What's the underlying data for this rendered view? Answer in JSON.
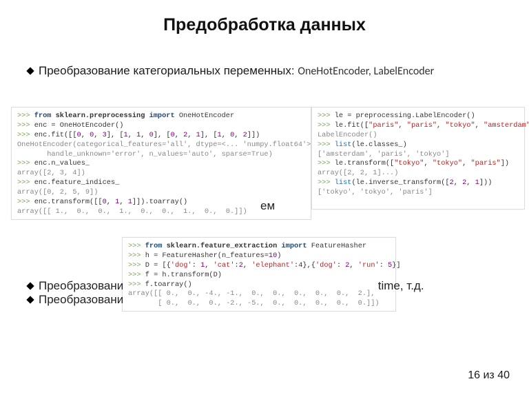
{
  "title": "Предобработка данных",
  "bullet1_text": "Преобразование категориальных переменных: ",
  "bullet1_enc": "OneHotEncoder, LabelEncoder",
  "code_left": {
    "l1a": ">>> ",
    "l1b": "from",
    "l1c": " sklearn.preprocessing ",
    "l1d": "import",
    "l1e": " OneHotEncoder",
    "l2a": ">>> ",
    "l2b": "enc = OneHotEncoder()",
    "l3a": ">>> ",
    "l3b": "enc.fit([[",
    "l3c": "0",
    "l3d": ", ",
    "l3e": "0",
    "l3f": ", ",
    "l3g": "3",
    "l3h": "], [",
    "l3i": "1",
    "l3j": ", ",
    "l3k": "1",
    "l3l": ", ",
    "l3m": "0",
    "l3n": "], [",
    "l3o": "0",
    "l3p": ", ",
    "l3q": "2",
    "l3r": ", ",
    "l3s": "1",
    "l3t": "], [",
    "l3u": "1",
    "l3v": ", ",
    "l3w": "0",
    "l3x": ", ",
    "l3y": "2",
    "l3z": "]])",
    "l4": "OneHotEncoder(categorical_features='all', dtype=<... 'numpy.float64'>,",
    "l5": "       handle_unknown='error', n_values='auto', sparse=True)",
    "l6a": ">>> ",
    "l6b": "enc.n_values_",
    "l7": "array([2, 3, 4])",
    "l8a": ">>> ",
    "l8b": "enc.feature_indices_",
    "l9": "array([0, 2, 5, 9])",
    "l10a": ">>> ",
    "l10b": "enc.transform([[",
    "l10c": "0",
    "l10d": ", ",
    "l10e": "1",
    "l10f": ", ",
    "l10g": "1",
    "l10h": "]]).toarray()",
    "l11": "array([[ 1.,  0.,  0.,  1.,  0.,  0.,  1.,  0.,  0.]])"
  },
  "code_right": {
    "l1a": ">>> ",
    "l1b": "le = preprocessing.LabelEncoder()",
    "l2a": ">>> ",
    "l2b": "le.fit([",
    "l2c": "\"paris\"",
    "l2d": ", ",
    "l2e": "\"paris\"",
    "l2f": ", ",
    "l2g": "\"tokyo\"",
    "l2h": ", ",
    "l2i": "\"amsterdam\"",
    "l2j": "])",
    "l3": "LabelEncoder()",
    "l4a": ">>> ",
    "l4b": "list",
    "l4c": "(le.classes_)",
    "l5": "['amsterdam', 'paris', 'tokyo']",
    "l6a": ">>> ",
    "l6b": "le.transform([",
    "l6c": "\"tokyo\"",
    "l6d": ", ",
    "l6e": "\"tokyo\"",
    "l6f": ", ",
    "l6g": "\"paris\"",
    "l6h": "])",
    "l7": "array([2, 2, 1]...)",
    "l8a": ">>> ",
    "l8b": "list",
    "l8c": "(le.inverse_transform([",
    "l8d": "2",
    "l8e": ", ",
    "l8f": "2",
    "l8g": ", ",
    "l8h": "1",
    "l8i": "]))",
    "l9": "['tokyo', 'tokyo', 'paris']"
  },
  "code_bottom": {
    "l1a": ">>> ",
    "l1b": "from",
    "l1c": " sklearn.feature_extraction ",
    "l1d": "import",
    "l1e": " FeatureHasher",
    "l2a": ">>> ",
    "l2b": "h = FeatureHasher(n_features=",
    "l2c": "10",
    "l2d": ")",
    "l3a": ">>> ",
    "l3b": "D = [{",
    "l3c": "'dog'",
    "l3d": ": ",
    "l3e": "1",
    "l3f": ", ",
    "l3g": "'cat'",
    "l3h": ":",
    "l3i": "2",
    "l3j": ", ",
    "l3k": "'elephant'",
    "l3l": ":",
    "l3m": "4",
    "l3n": "},{",
    "l3o": "'dog'",
    "l3p": ": ",
    "l3q": "2",
    "l3r": ", ",
    "l3s": "'run'",
    "l3t": ": ",
    "l3u": "5",
    "l3v": "}]",
    "l4a": ">>> ",
    "l4b": "f = h.transform(D)",
    "l5a": ">>> ",
    "l5b": "f.toarray()",
    "l6": "array([[ 0.,  0., -4., -1.,  0.,  0.,  0.,  0.,  0.,  2.],",
    "l7": "       [ 0.,  0.,  0., -2., -5.,  0.,  0.,  0.,  0.,  0.]])"
  },
  "fragment_em": "ем",
  "bullet_time_pre": "Преобразовани",
  "bullet_time_post": "time, т.д.",
  "bullet_unf": "Преобразовани",
  "page_number": "16 из 40"
}
